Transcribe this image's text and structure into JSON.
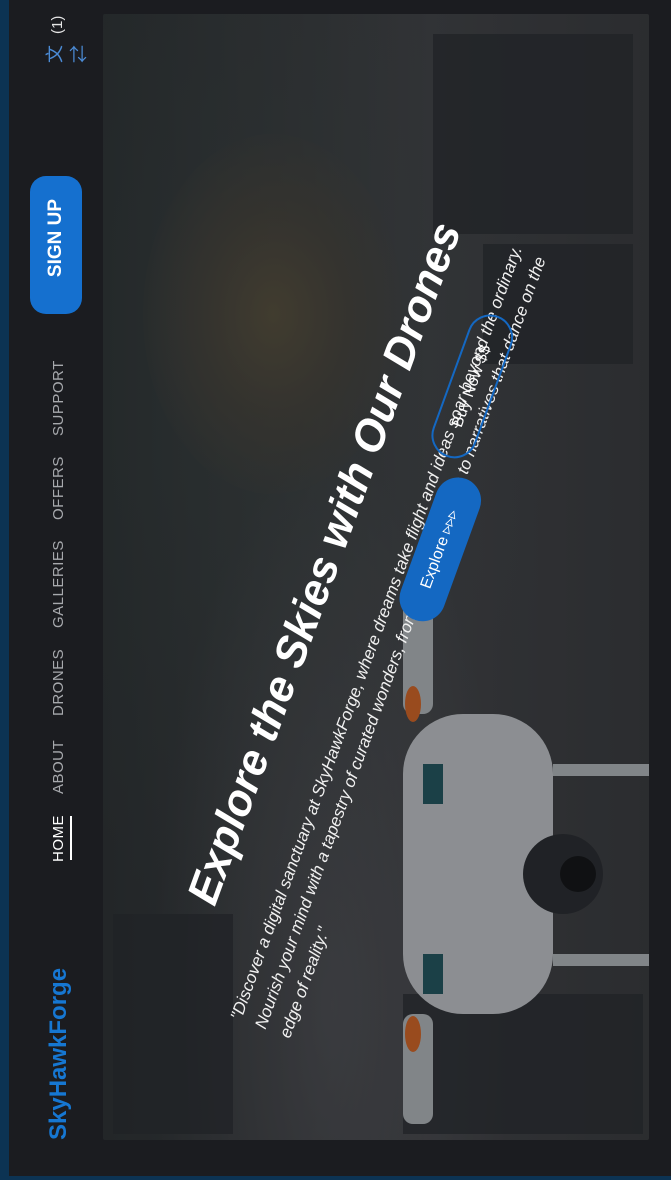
{
  "brand": {
    "name": "SkyHawkForge",
    "accent": "#1677d2"
  },
  "language": {
    "icon": "translate-icon",
    "count": "(1)"
  },
  "nav": {
    "items": [
      {
        "label": "HOME",
        "active": true
      },
      {
        "label": "ABOUT"
      },
      {
        "label": "DRONES"
      },
      {
        "label": "GALLERIES"
      },
      {
        "label": "OFFERS"
      },
      {
        "label": "SUPPORT"
      }
    ],
    "signup_label": "SIGN UP"
  },
  "hero": {
    "title": "Explore the Skies with Our Drones",
    "description": "\"Discover a digital sanctuary at SkyHawkForge, where dreams take flight and ideas soar beyond the ordinary. Nourish your mind with a tapestry of curated wonders, from visionary artworks to narratives that dance on the edge of reality.\"",
    "explore_label": "Explore ▹▹▹",
    "buy_label": "Buy Now $$"
  }
}
